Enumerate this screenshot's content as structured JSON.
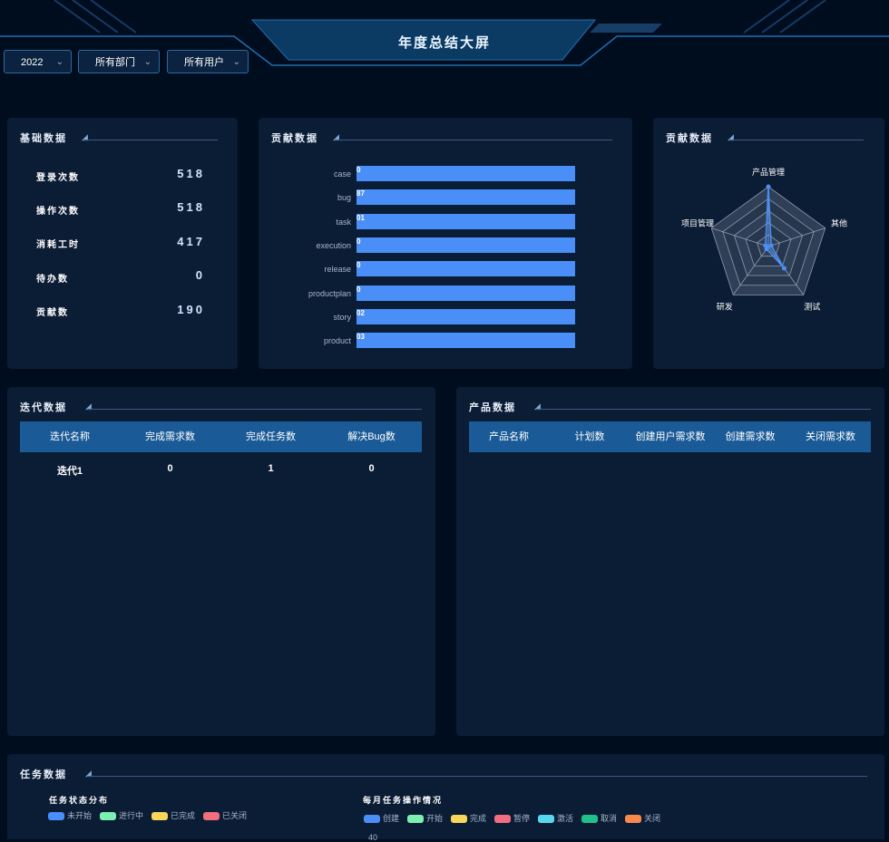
{
  "header": {
    "title": "年度总结大屏",
    "filters": [
      {
        "value": "2022"
      },
      {
        "value": "所有部门"
      },
      {
        "value": "所有用户"
      }
    ]
  },
  "basic": {
    "title": "基础数据",
    "items": [
      {
        "label": "登录次数",
        "value": "518"
      },
      {
        "label": "操作次数",
        "value": "518"
      },
      {
        "label": "消耗工时",
        "value": "417"
      },
      {
        "label": "待办数",
        "value": "0"
      },
      {
        "label": "贡献数",
        "value": "190"
      }
    ]
  },
  "contrib_bar": {
    "title": "贡献数据",
    "chart_data": {
      "type": "bar",
      "orientation": "horizontal",
      "categories": [
        "case",
        "bug",
        "task",
        "execution",
        "release",
        "productplan",
        "story",
        "product"
      ],
      "labels": [
        "0",
        "87",
        "01",
        "0",
        "0",
        "0",
        "02",
        "03"
      ]
    }
  },
  "contrib_radar": {
    "title": "贡献数据",
    "chart_data": {
      "type": "radar",
      "axes": [
        "产品管理",
        "其他",
        "测试",
        "研发",
        "项目管理"
      ],
      "values": [
        1.0,
        0.05,
        0.45,
        0.05,
        0.05
      ]
    }
  },
  "iteration": {
    "title": "迭代数据",
    "columns": [
      "迭代名称",
      "完成需求数",
      "完成任务数",
      "解决Bug数"
    ],
    "rows": [
      [
        "迭代1",
        "0",
        "1",
        "0"
      ]
    ]
  },
  "product": {
    "title": "产品数据",
    "columns": [
      "产品名称",
      "计划数",
      "创建用户需求数",
      "创建需求数",
      "关闭需求数"
    ]
  },
  "tasks": {
    "title": "任务数据",
    "status": {
      "title": "任务状态分布",
      "legend": [
        {
          "label": "未开始",
          "color": "#4a8ff8"
        },
        {
          "label": "进行中",
          "color": "#7cf0b0"
        },
        {
          "label": "已完成",
          "color": "#f8d65a"
        },
        {
          "label": "已关闭",
          "color": "#f06e7e"
        }
      ]
    },
    "monthly": {
      "title": "每月任务操作情况",
      "legend": [
        {
          "label": "创建",
          "color": "#4a8ff8"
        },
        {
          "label": "开始",
          "color": "#7cf0b0"
        },
        {
          "label": "完成",
          "color": "#f8d65a"
        },
        {
          "label": "暂停",
          "color": "#f06e7e"
        },
        {
          "label": "激活",
          "color": "#58d8f0"
        },
        {
          "label": "取消",
          "color": "#1fc08a"
        },
        {
          "label": "关闭",
          "color": "#f8894a"
        }
      ],
      "ytick": "40"
    }
  }
}
